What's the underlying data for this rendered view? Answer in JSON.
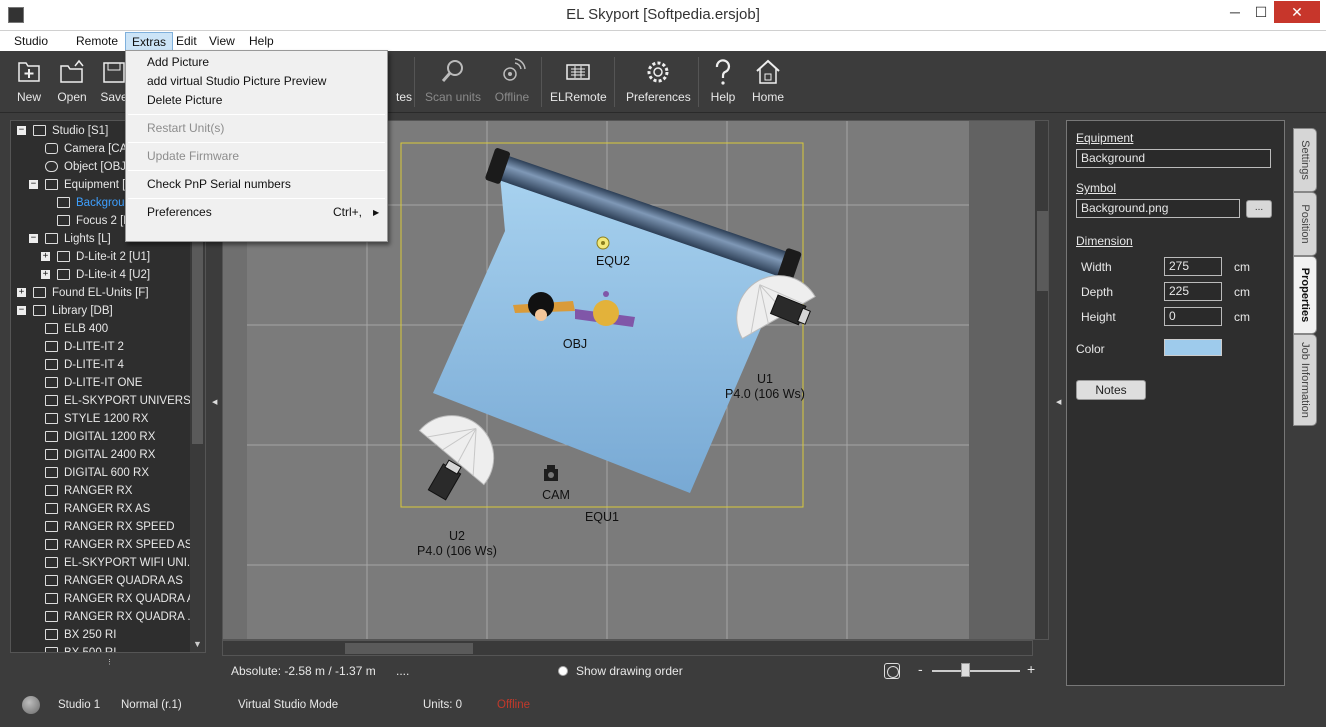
{
  "window": {
    "title": "EL Skyport [Softpedia.ersjob]",
    "minimize": "─",
    "maximize": "☐",
    "close": "✕"
  },
  "menubar": [
    "Studio",
    "Remote",
    "Extras",
    "Edit",
    "View",
    "Help"
  ],
  "extras_menu": {
    "items": [
      "Add Picture",
      "add virtual Studio Picture Preview",
      "Delete Picture",
      "Restart Unit(s)",
      "Update Firmware",
      "Check PnP Serial numbers",
      "Preferences"
    ],
    "preferences_shortcut": "Ctrl+,",
    "submenu_arrow": "▶"
  },
  "toolbar": {
    "new": "New",
    "open": "Open",
    "save": "Save",
    "notes_partial": "tes",
    "scan_units": "Scan units",
    "offline": "Offline",
    "elremote": "ELRemote",
    "preferences": "Preferences",
    "help": "Help",
    "home": "Home"
  },
  "tree": {
    "items": [
      "Studio [S1]",
      "Camera [CAM]",
      "Object [OBJ]",
      "Equipment [",
      "Backgrou",
      "Focus 2 [E",
      "Lights  [L]",
      "D-Lite-it 2 [U1]",
      "D-Lite-it 4 [U2]",
      "Found EL-Units [F]",
      "Library [DB]",
      "ELB 400",
      "D-LITE-IT 2",
      "D-LITE-IT 4",
      "D-LITE-IT ONE",
      "EL-SKYPORT UNIVERSAL",
      "STYLE 1200 RX",
      "DIGITAL 1200 RX",
      "DIGITAL 2400 RX",
      "DIGITAL 600 RX",
      "RANGER RX",
      "RANGER RX AS",
      "RANGER RX SPEED",
      "RANGER RX SPEED AS",
      "EL-SKYPORT WIFI UNI...",
      "RANGER QUADRA AS",
      "RANGER RX QUADRA AS",
      "RANGER RX QUADRA ...",
      "BX 250 RI",
      "BX 500 RI"
    ],
    "toggle_minus": "−",
    "toggle_plus": "+"
  },
  "canvas": {
    "labels": {
      "equ2": "EQU2",
      "obj": "OBJ",
      "u1_name": "U1",
      "u1_power": "P4.0 (106 Ws)",
      "cam": "CAM",
      "equ1": "EQU1",
      "u2_name": "U2",
      "u2_power": "P4.0 (106 Ws)"
    },
    "background_color": "#9ecbec"
  },
  "canvas_status": {
    "absolute": "Absolute: -2.58 m / -1.37 m",
    "dots": "....",
    "show_drawing_order": "Show drawing order",
    "zoom_minus": "-",
    "zoom_plus": "+",
    "zoom_level": 0.38
  },
  "properties": {
    "equipment_heading": "Equipment",
    "equipment_value": "Background",
    "symbol_heading": "Symbol",
    "symbol_value": "Background.png",
    "symbol_browse": "...",
    "dimension_heading": "Dimension",
    "width_label": "Width",
    "width_value": "275",
    "depth_label": "Depth",
    "depth_value": "225",
    "height_label": "Height",
    "height_value": "0",
    "unit": "cm",
    "color_label": "Color",
    "color_value": "#9ecbec",
    "notes_button": "Notes"
  },
  "side_tabs": [
    "Settings",
    "Position",
    "Properties",
    "Job Information"
  ],
  "statusbar": {
    "studio": "Studio 1",
    "mode": "Normal (r.1)",
    "virtual": "Virtual Studio Mode",
    "units": "Units: 0",
    "connection": "Offline"
  }
}
